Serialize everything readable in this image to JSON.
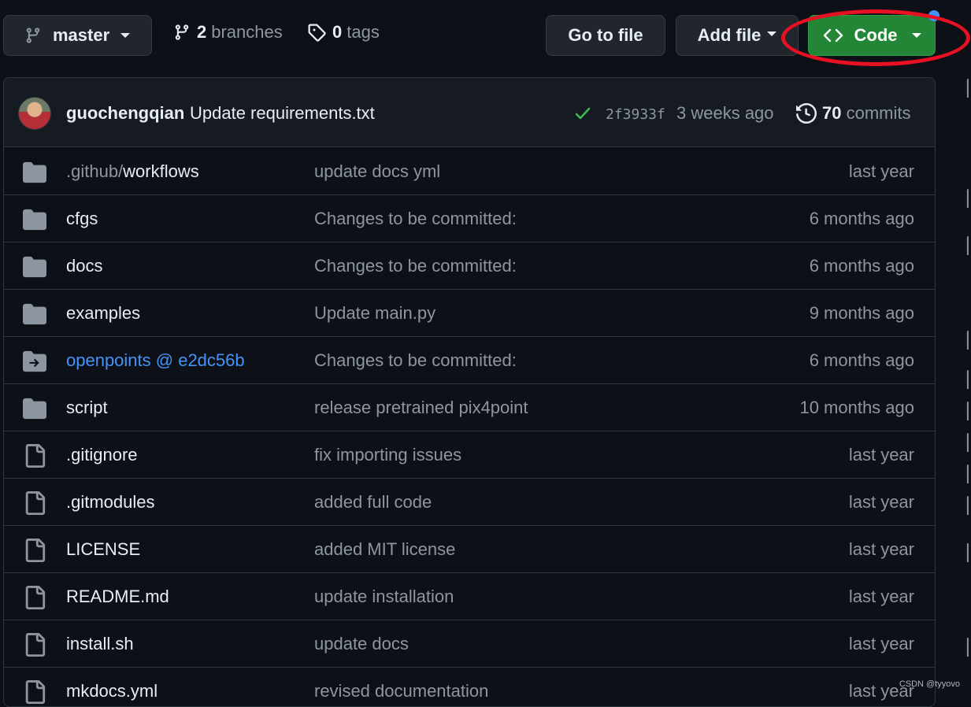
{
  "toolbar": {
    "branch_name": "master",
    "branch_count": "2",
    "branches_label": "branches",
    "tag_count": "0",
    "tags_label": "tags",
    "go_to_file": "Go to file",
    "add_file": "Add file",
    "code": "Code"
  },
  "commit": {
    "author": "guochengqian",
    "message": "Update requirements.txt",
    "hash": "2f3933f",
    "time": "3 weeks ago",
    "count": "70",
    "count_label": "commits"
  },
  "files": [
    {
      "type": "folder",
      "name_prefix": ".github/",
      "name": "workflows",
      "message": "update docs yml",
      "date": "last year"
    },
    {
      "type": "folder",
      "name_prefix": "",
      "name": "cfgs",
      "message": "Changes to be committed:",
      "date": "6 months ago"
    },
    {
      "type": "folder",
      "name_prefix": "",
      "name": "docs",
      "message": "Changes to be committed:",
      "date": "6 months ago"
    },
    {
      "type": "folder",
      "name_prefix": "",
      "name": "examples",
      "message": "Update main.py",
      "date": "9 months ago"
    },
    {
      "type": "submodule",
      "name_prefix": "",
      "name": "openpoints @ e2dc56b",
      "message": "Changes to be committed:",
      "date": "6 months ago"
    },
    {
      "type": "folder",
      "name_prefix": "",
      "name": "script",
      "message": "release pretrained pix4point",
      "date": "10 months ago"
    },
    {
      "type": "file",
      "name_prefix": "",
      "name": ".gitignore",
      "message": "fix importing issues",
      "date": "last year"
    },
    {
      "type": "file",
      "name_prefix": "",
      "name": ".gitmodules",
      "message": "added full code",
      "date": "last year"
    },
    {
      "type": "file",
      "name_prefix": "",
      "name": "LICENSE",
      "message": "added MIT license",
      "date": "last year"
    },
    {
      "type": "file",
      "name_prefix": "",
      "name": "README.md",
      "message": "update installation",
      "date": "last year"
    },
    {
      "type": "file",
      "name_prefix": "",
      "name": "install.sh",
      "message": "update docs",
      "date": "last year"
    },
    {
      "type": "file",
      "name_prefix": "",
      "name": "mkdocs.yml",
      "message": "revised documentation",
      "date": "last year"
    }
  ],
  "watermark": "CSDN @tyyovo",
  "colors": {
    "background": "#0d1117",
    "code_button": "#238636",
    "link": "#4493f8",
    "highlight_annotation": "#e81123"
  }
}
